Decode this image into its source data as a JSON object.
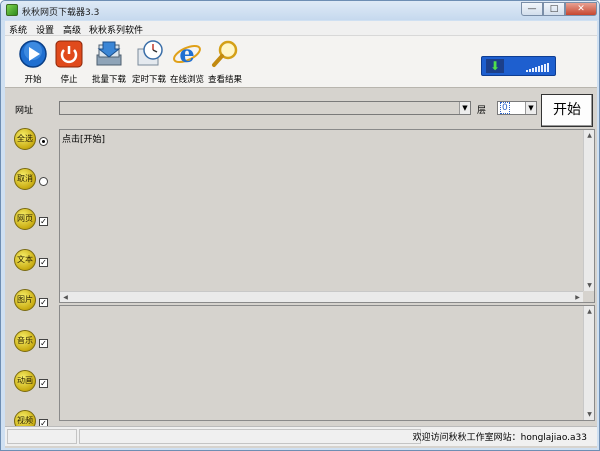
{
  "window": {
    "title": "秋秋网页下载器3.3",
    "min": "—",
    "max": "□",
    "close": "✕"
  },
  "menu": [
    "系统",
    "设置",
    "高级",
    "秋秋系列软件"
  ],
  "toolbar": [
    {
      "label": "开始",
      "icon": "play-icon"
    },
    {
      "label": "停止",
      "icon": "power-stop-icon"
    },
    {
      "label": "批量下载",
      "icon": "batch-download-icon"
    },
    {
      "label": "定时下载",
      "icon": "clock-icon"
    },
    {
      "label": "在线浏览",
      "icon": "ie-browser-icon"
    },
    {
      "label": "查看结果",
      "icon": "magnifier-icon"
    }
  ],
  "speed_arrow": "⬇",
  "url": {
    "label": "网址",
    "value": ""
  },
  "layer": {
    "label": "层",
    "value": "0"
  },
  "start_button": "开始",
  "side": [
    {
      "label": "全选",
      "control": "radio",
      "checked": true
    },
    {
      "label": "取消",
      "control": "radio",
      "checked": false
    },
    {
      "label": "网页",
      "control": "checkbox",
      "checked": true
    },
    {
      "label": "文本",
      "control": "checkbox",
      "checked": true
    },
    {
      "label": "图片",
      "control": "checkbox",
      "checked": true
    },
    {
      "label": "音乐",
      "control": "checkbox",
      "checked": true
    },
    {
      "label": "动画",
      "control": "checkbox",
      "checked": true
    },
    {
      "label": "视频",
      "control": "checkbox",
      "checked": true
    }
  ],
  "check_mark": "✓",
  "log_text": "点击[开始]",
  "status": {
    "right": "欢迎访问秋秋工作室网站：honglajiao.a33"
  },
  "colors": {
    "titlebar": "#c6d9ee",
    "face": "#d6d3ce",
    "speed_bg": "#1e5fcf",
    "side_button": "#e0cc30"
  }
}
